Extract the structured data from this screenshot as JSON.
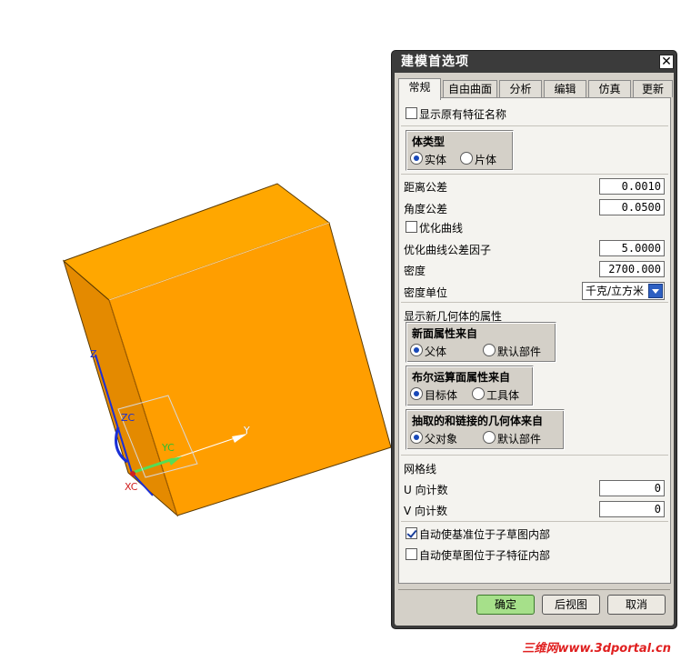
{
  "dialog": {
    "title": "建模首选项",
    "close_glyph": "✕",
    "tabs": [
      {
        "label": "常规",
        "active": true
      },
      {
        "label": "自由曲面"
      },
      {
        "label": "分析"
      },
      {
        "label": "编辑"
      },
      {
        "label": "仿真"
      },
      {
        "label": "更新"
      }
    ],
    "general": {
      "show_feature_names": {
        "label": "显示原有特征名称",
        "checked": false
      },
      "body_type": {
        "title": "体类型",
        "options": [
          "实体",
          "片体"
        ],
        "selected": "实体"
      },
      "distance_tolerance": {
        "label": "距离公差",
        "value": "0.0010"
      },
      "angle_tolerance": {
        "label": "角度公差",
        "value": "0.0500"
      },
      "optimize_curve": {
        "label": "优化曲线",
        "checked": false
      },
      "optimize_curve_factor": {
        "label": "优化曲线公差因子",
        "value": "5.0000"
      },
      "density": {
        "label": "密度",
        "value": "2700.000"
      },
      "density_unit": {
        "label": "密度单位",
        "value": "千克/立方米"
      },
      "new_geometry_section": "显示新几何体的属性",
      "face_props": {
        "title": "新面属性来自",
        "options": [
          "父体",
          "默认部件"
        ],
        "selected": "父体"
      },
      "boolean_props": {
        "title": "布尔运算面属性来自",
        "options": [
          "目标体",
          "工具体"
        ],
        "selected": "目标体"
      },
      "extracted_props": {
        "title": "抽取的和链接的几何体来自",
        "options": [
          "父对象",
          "默认部件"
        ],
        "selected": "父对象"
      },
      "grid_section": "网格线",
      "u_count": {
        "label": "U 向计数",
        "value": "0"
      },
      "v_count": {
        "label": "V 向计数",
        "value": "0"
      },
      "auto_datum": {
        "label": "自动使基准位于子草图内部",
        "checked": true
      },
      "auto_sketch": {
        "label": "自动使草图位于子特征内部",
        "checked": false
      }
    },
    "buttons": {
      "ok": "确定",
      "back": "后视图",
      "cancel": "取消"
    }
  },
  "viewport": {
    "axes": {
      "z": "Z",
      "zc": "ZC",
      "yc": "YC",
      "y": "Y",
      "xc": "XC"
    },
    "colors": {
      "box_front": "#FF9E00",
      "box_top": "#FFA700",
      "box_side": "#E48A00",
      "edge": "#5a3a00"
    }
  },
  "watermark": "三维网www.3dportal.cn"
}
